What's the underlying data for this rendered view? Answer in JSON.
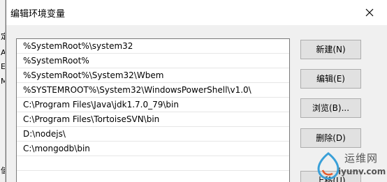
{
  "background_window": {
    "letters": [
      "定",
      "A",
      "E",
      "M",
      "值"
    ]
  },
  "dialog": {
    "title": "编辑环境变量",
    "close_icon": "close-icon"
  },
  "paths": [
    "%SystemRoot%\\system32",
    "%SystemRoot%",
    "%SystemRoot%\\System32\\Wbem",
    "%SYSTEMROOT%\\System32\\WindowsPowerShell\\v1.0\\",
    "C:\\Program Files\\Java\\jdk1.7.0_79\\bin",
    "C:\\Program Files\\TortoiseSVN\\bin",
    "D:\\nodejs\\",
    "C:\\mongodb\\bin"
  ],
  "buttons": {
    "new": "新建(N)",
    "edit": "编辑(E)",
    "browse": "浏览(B)...",
    "delete": "删除(D)",
    "move_up": "上移(U)"
  },
  "watermark": {
    "cn": "运维网",
    "en": "iyunv.com"
  },
  "colors": {
    "dialog_bg": "#f0f0f0",
    "list_bg": "#ffffff",
    "button_bg": "#e1e1e1",
    "logo_accent": "#3aa0d8"
  }
}
